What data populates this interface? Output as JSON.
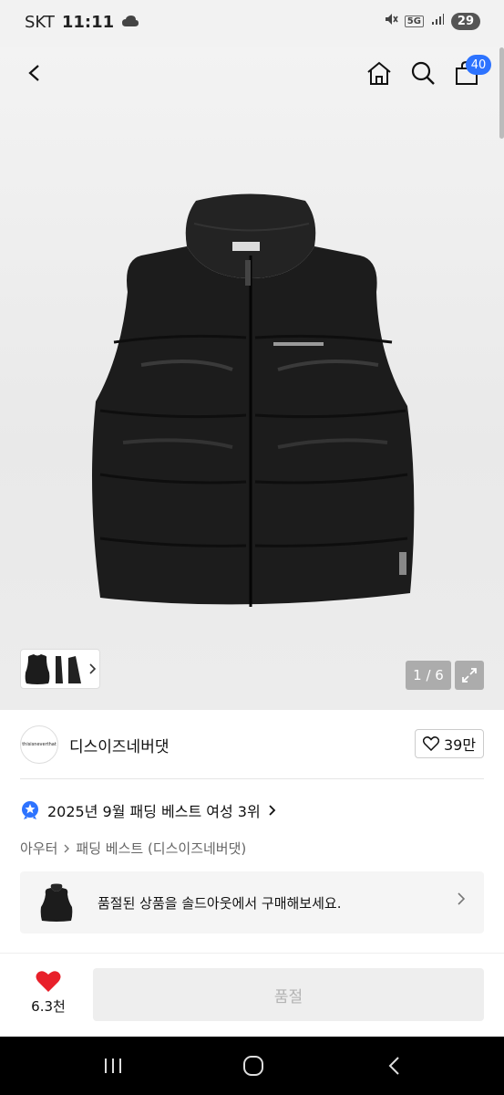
{
  "status_bar": {
    "carrier": "SKT",
    "time": "11:11",
    "network": "5G",
    "battery": "29"
  },
  "nav": {
    "cart_count": "40"
  },
  "gallery": {
    "counter": "1 / 6"
  },
  "brand": {
    "logo_text": "thisisneverthat",
    "name": "디스이즈네버댓",
    "like_count": "39만"
  },
  "product": {
    "ranking": "2025년 9월 패딩 베스트 여성 3위",
    "breadcrumb": [
      "아우터",
      "패딩 베스트 (디스이즈네버댓)"
    ],
    "soldout_text": "품절된 상품을 솔드아웃에서 구매해보세요."
  },
  "bottom_bar": {
    "wish_count": "6.3천",
    "buy_label": "품절"
  },
  "colors": {
    "accent": "#2d73ff",
    "heart": "#e8202a",
    "vest": "#1c1c1c"
  }
}
